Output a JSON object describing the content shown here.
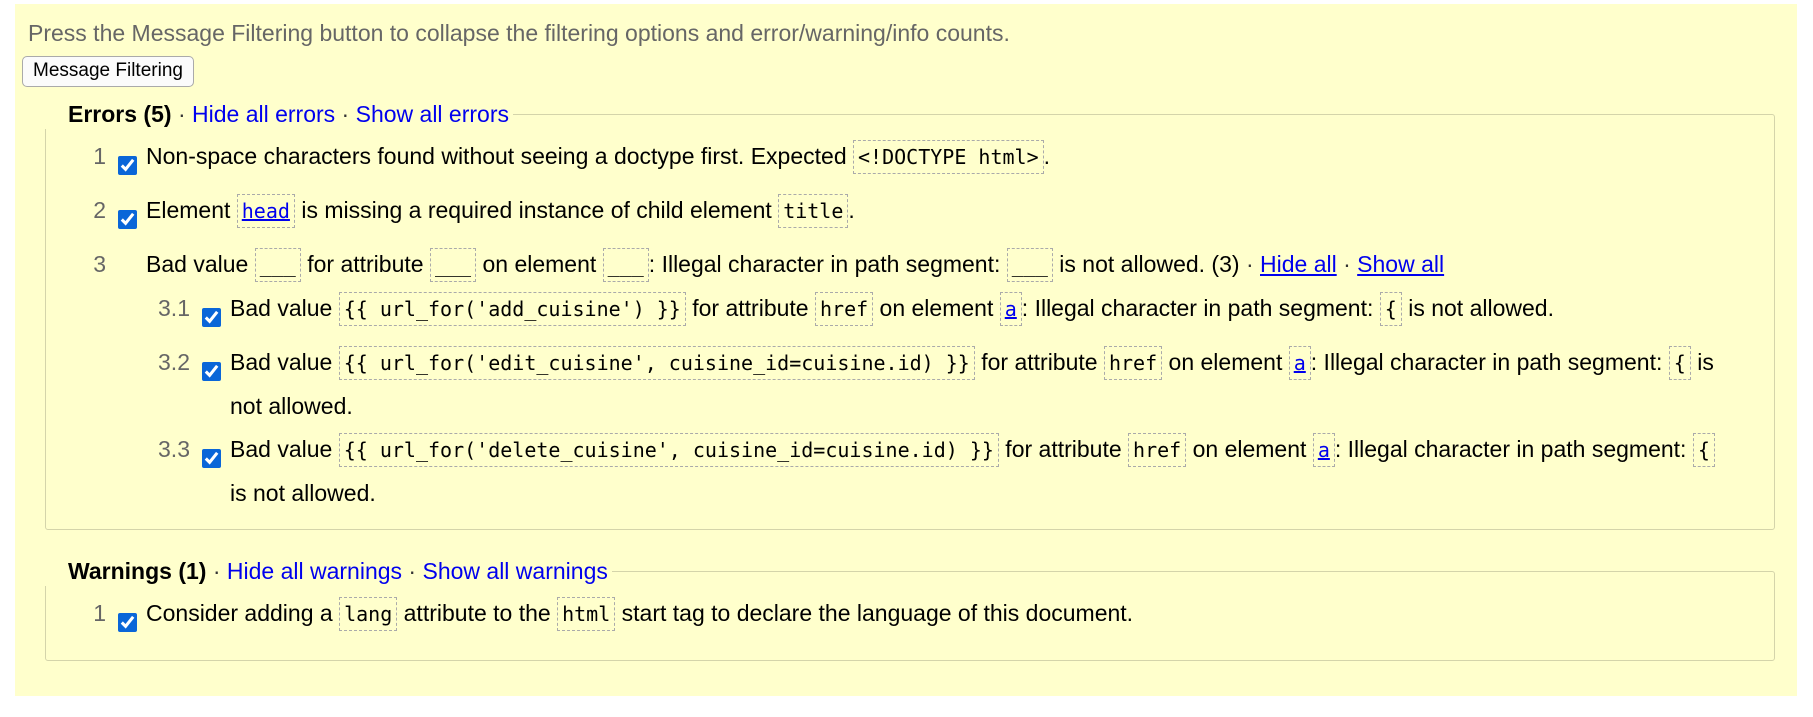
{
  "intro": "Press the Message Filtering button to collapse the filtering options and error/warning/info counts.",
  "filter_button": "Message Filtering",
  "errors": {
    "title": "Errors (5)",
    "hide_all": "Hide all errors",
    "show_all": "Show all errors",
    "sep": "·",
    "items": [
      {
        "num": "1",
        "t1": "Non-space characters found without seeing a doctype first. Expected ",
        "c1": "<!DOCTYPE html>",
        "t2": "."
      },
      {
        "num": "2",
        "t1": "Element ",
        "c1": "head",
        "t2": " is missing a required instance of child element ",
        "c2": "title",
        "t3": "."
      }
    ],
    "group": {
      "num": "3",
      "t1": "Bad value ",
      "c1": "___",
      "t2": " for attribute ",
      "c2": "___",
      "t3": " on element ",
      "c3": "___",
      "t4": ": Illegal character in path segment: ",
      "c4": "___",
      "t5": " is not allowed. (3) ",
      "hide_all": "Hide all",
      "show_all": "Show all",
      "subs": [
        {
          "num": "3.1",
          "t1": "Bad value ",
          "c1": "{{ url_for('add_cuisine') }}",
          "t2": " for attribute ",
          "c2": "href",
          "t3": " on element ",
          "c3": "a",
          "t4": ": Illegal character in path segment: ",
          "c4": "{",
          "t5": " is not allowed."
        },
        {
          "num": "3.2",
          "t1": "Bad value ",
          "c1": "{{ url_for('edit_cuisine', cuisine_id=cuisine.id) }}",
          "t2": " for attribute ",
          "c2": "href",
          "t3": " on element ",
          "c3": "a",
          "t4": ": Illegal character in path segment: ",
          "c4": "{",
          "t5": " is not allowed."
        },
        {
          "num": "3.3",
          "t1": "Bad value ",
          "c1": "{{ url_for('delete_cuisine', cuisine_id=cuisine.id) }}",
          "t2": " for attribute ",
          "c2": "href",
          "t3": " on element ",
          "c3": "a",
          "t4": ": Illegal character in path segment: ",
          "c4": "{",
          "t5": " is not allowed."
        }
      ]
    }
  },
  "warnings": {
    "title": "Warnings (1)",
    "hide_all": "Hide all warnings",
    "show_all": "Show all warnings",
    "sep": "·",
    "items": [
      {
        "num": "1",
        "t1": "Consider adding a ",
        "c1": "lang",
        "t2": " attribute to the ",
        "c2": "html",
        "t3": " start tag to declare the language of this document."
      }
    ]
  }
}
